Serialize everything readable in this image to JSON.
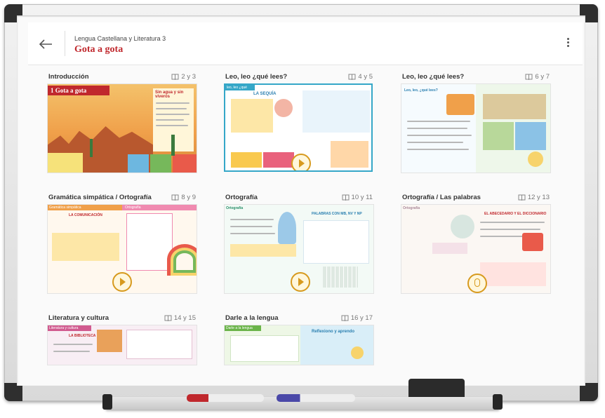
{
  "header": {
    "subtitle": "Lengua Castellana y Literatura 3",
    "title": "Gota a gota"
  },
  "cards": [
    {
      "title": "Introducción",
      "pages": "2 y 3"
    },
    {
      "title": "Leo, leo ¿qué lees?",
      "pages": "4 y 5"
    },
    {
      "title": "Leo, leo ¿qué lees?",
      "pages": "6 y 7"
    },
    {
      "title": "Gramática simpática / Ortografía",
      "pages": "8 y 9"
    },
    {
      "title": "Ortografía",
      "pages": "10 y 11"
    },
    {
      "title": "Ortografía / Las palabras",
      "pages": "12 y 13"
    },
    {
      "title": "Literatura y cultura",
      "pages": "14 y 15"
    },
    {
      "title": "Darle a la lengua",
      "pages": "16 y 17"
    }
  ],
  "thumbs": {
    "intro_banner": "1 Gota a gota",
    "intro_heading": "Sin agua y sin viveros",
    "p45_heading": "LA SEQUÍA",
    "p45_tab": "leo, leo ¿qué lees?",
    "p67_tab": "Leo, leo, ¿qué lees?",
    "p89_left": "Gramática simpática",
    "p89_right": "Ortografía",
    "p89_heading": "LA COMUNICACIÓN",
    "p1011_tab": "Ortografía",
    "p1011_heading": "PALABRAS CON MB, NV Y NP",
    "p1213_tab": "Ortografía",
    "p1213_heading": "EL ABECEDARIO Y EL DICCIONARIO",
    "p1415_tab": "Literatura y cultura",
    "p1415_heading": "LA BIBLIOTECA",
    "p1617_tab": "Darle a la lengua",
    "p1617_right": "Reflexiono y aprendo"
  },
  "icons": [
    "back-arrow-icon",
    "more-vert-icon",
    "book-icon",
    "play-icon",
    "mouse-icon"
  ],
  "colors": {
    "accent": "#c0282d",
    "play": "#d79a1e"
  }
}
